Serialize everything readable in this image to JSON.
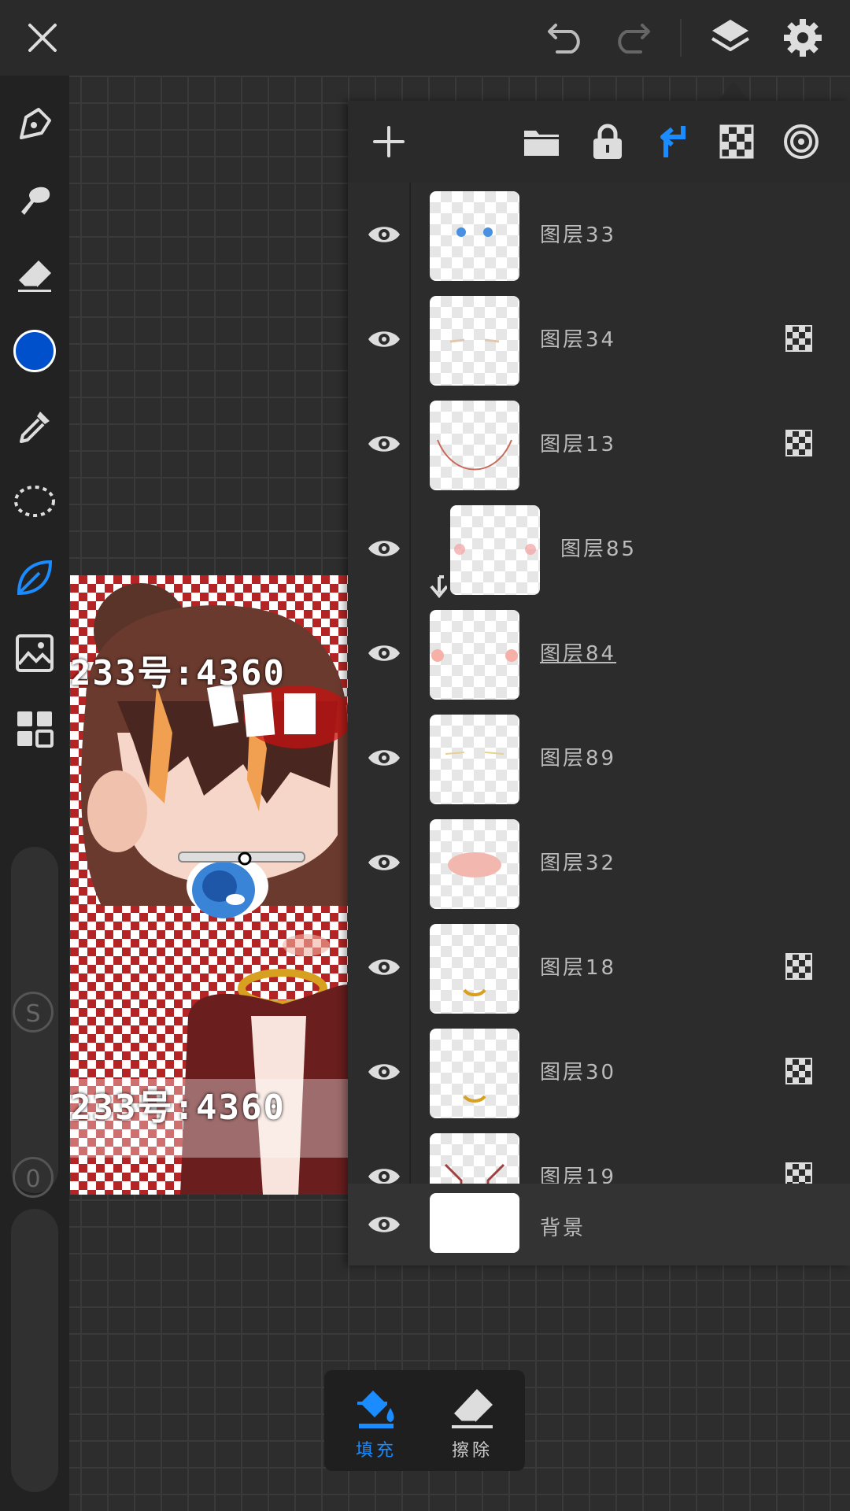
{
  "top_bar": {
    "close_icon": "close-icon",
    "undo_icon": "undo-icon",
    "redo_icon": "redo-icon",
    "layers_icon": "layers-icon",
    "settings_icon": "gear-icon"
  },
  "tools": {
    "active_color": "#0050cc",
    "items": [
      "pen-icon",
      "smudge-icon",
      "eraser-icon",
      "color-swatch",
      "eyedropper-icon",
      "lasso-icon",
      "leaf-brush-icon",
      "image-import-icon",
      "grid-icon"
    ],
    "size_label": "S",
    "opacity_label": "0"
  },
  "artwork": {
    "watermark_top": "233号:4360",
    "watermark_bottom": "233号:4360"
  },
  "layers_toolbar": {
    "add_icon": "plus-icon",
    "folder_icon": "folder-icon",
    "lock_icon": "lock-icon",
    "clip_icon": "clipping-mask-icon",
    "alpha_icon": "checkerboard-icon",
    "target_icon": "target-icon",
    "accent": "#1a8cff"
  },
  "layers": [
    {
      "name": "图层33",
      "alpha_lock": false,
      "clipped": false,
      "underline": false
    },
    {
      "name": "图层34",
      "alpha_lock": true,
      "clipped": false,
      "underline": false
    },
    {
      "name": "图层13",
      "alpha_lock": true,
      "clipped": false,
      "underline": false
    },
    {
      "name": "图层85",
      "alpha_lock": false,
      "clipped": true,
      "underline": false
    },
    {
      "name": "图层84",
      "alpha_lock": false,
      "clipped": false,
      "underline": true
    },
    {
      "name": "图层89",
      "alpha_lock": false,
      "clipped": false,
      "underline": false
    },
    {
      "name": "图层32",
      "alpha_lock": false,
      "clipped": false,
      "underline": false
    },
    {
      "name": "图层18",
      "alpha_lock": true,
      "clipped": false,
      "underline": false
    },
    {
      "name": "图层30",
      "alpha_lock": true,
      "clipped": false,
      "underline": false
    },
    {
      "name": "图层19",
      "alpha_lock": true,
      "clipped": false,
      "underline": false
    }
  ],
  "background_layer": {
    "name": "背景"
  },
  "actions": {
    "fill_label": "填充",
    "erase_label": "擦除",
    "active_color": "#1a8cff"
  }
}
